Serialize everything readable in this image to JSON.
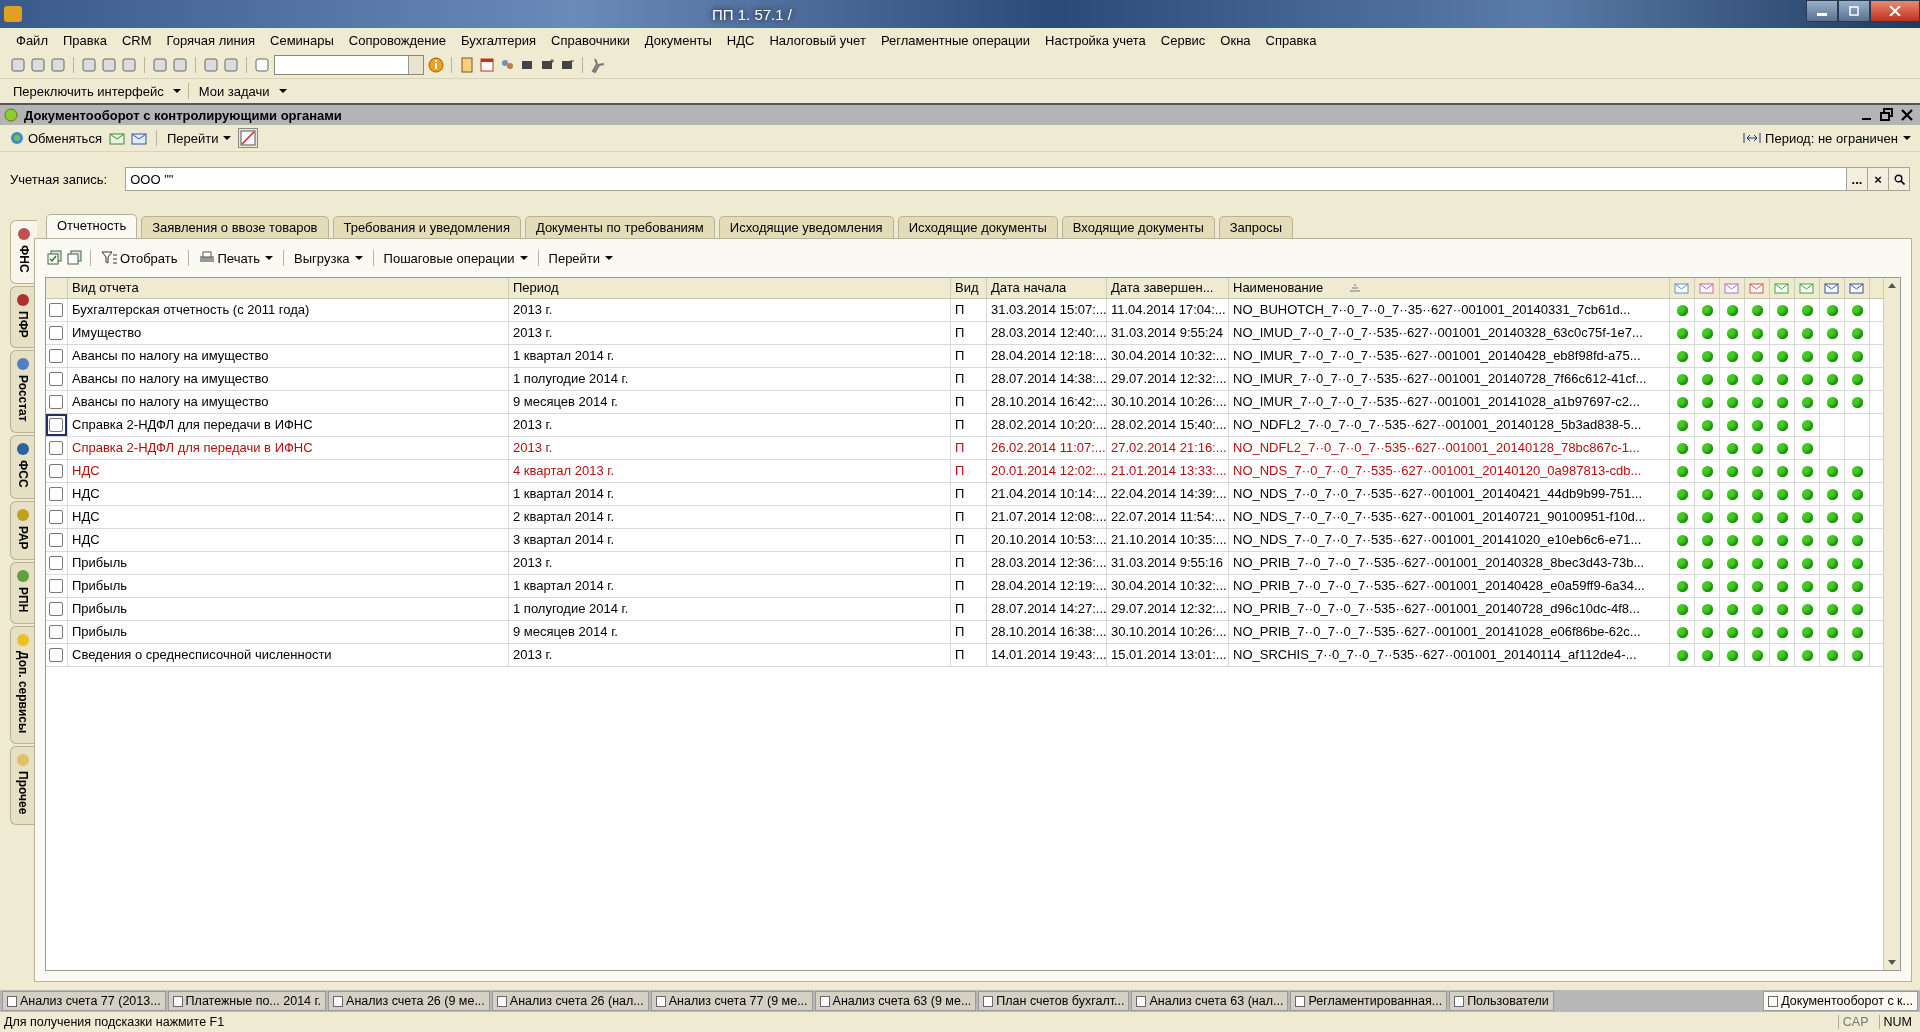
{
  "window": {
    "title": "ПП 1.  57.1 /"
  },
  "menu": [
    "Файл",
    "Правка",
    "CRM",
    "Горячая линия",
    "Семинары",
    "Сопровождение",
    "Бухгалтерия",
    "Справочники",
    "Документы",
    "НДС",
    "Налоговый учет",
    "Регламентные операции",
    "Настройка учета",
    "Сервис",
    "Окна",
    "Справка"
  ],
  "panel_buttons": [
    "Переключить интерфейс",
    "Мои задачи"
  ],
  "document": {
    "title": "Документооборот с контролирующими органами",
    "toolbar": {
      "exchange": "Обменяться",
      "goto": "Перейти",
      "period": "Период: не ограничен"
    },
    "account": {
      "label": "Учетная запись:",
      "value": "ООО \"\"",
      "buttons": [
        "...",
        "×"
      ]
    },
    "side_tabs": [
      {
        "label": "ФНС",
        "selected": true
      },
      {
        "label": "ПФР",
        "selected": false
      },
      {
        "label": "Росстат",
        "selected": false
      },
      {
        "label": "ФСС",
        "selected": false
      },
      {
        "label": "РАР",
        "selected": false
      },
      {
        "label": "РПН",
        "selected": false
      },
      {
        "label": "Доп. сервисы",
        "selected": false
      },
      {
        "label": "Прочее",
        "selected": false
      }
    ],
    "tabs": [
      {
        "label": "Отчетность",
        "selected": true
      },
      {
        "label": "Заявления о ввозе товаров",
        "selected": false
      },
      {
        "label": "Требования и уведомления",
        "selected": false
      },
      {
        "label": "Документы по требованиям",
        "selected": false
      },
      {
        "label": "Исходящие уведомления",
        "selected": false
      },
      {
        "label": "Исходящие документы",
        "selected": false
      },
      {
        "label": "Входящие документы",
        "selected": false
      },
      {
        "label": "Запросы",
        "selected": false
      }
    ],
    "list_toolbar": {
      "filter": "Отобрать",
      "print": "Печать",
      "export": "Выгрузка",
      "steps": "Пошаговые операции",
      "goto": "Перейти"
    },
    "table": {
      "columns": [
        "Вид отчета",
        "Период",
        "Вид",
        "Дата начала",
        "Дата завершен...",
        "Наименование"
      ],
      "rows": [
        {
          "checked": false,
          "focused": false,
          "error": false,
          "cells": [
            "Бухгалтерская отчетность (с 2011 года)",
            "2013 г.",
            "П",
            "31.03.2014 15:07:...",
            "11.04.2014 17:04:...",
            "NO_BUHOTCH_7··0_7··0_7··35··627··001001_20140331_7cb61d..."
          ],
          "indicators": [
            true,
            true,
            true,
            true,
            true,
            true,
            true,
            true
          ]
        },
        {
          "checked": false,
          "focused": false,
          "error": false,
          "cells": [
            "Имущество",
            "2013 г.",
            "П",
            "28.03.2014 12:40:...",
            "31.03.2014 9:55:24",
            "NO_IMUD_7··0_7··0_7··535··627··001001_20140328_63c0c75f-1e7..."
          ],
          "indicators": [
            true,
            true,
            true,
            true,
            true,
            true,
            true,
            true
          ]
        },
        {
          "checked": false,
          "focused": false,
          "error": false,
          "cells": [
            "Авансы по налогу на имущество",
            "1 квартал 2014 г.",
            "П",
            "28.04.2014 12:18:...",
            "30.04.2014 10:32:...",
            "NO_IMUR_7··0_7··0_7··535··627··001001_20140428_eb8f98fd-a75..."
          ],
          "indicators": [
            true,
            true,
            true,
            true,
            true,
            true,
            true,
            true
          ]
        },
        {
          "checked": false,
          "focused": false,
          "error": false,
          "cells": [
            "Авансы по налогу на имущество",
            "1 полугодие 2014 г.",
            "П",
            "28.07.2014 14:38:...",
            "29.07.2014 12:32:...",
            "NO_IMUR_7··0_7··0_7··535··627··001001_20140728_7f66c612-41cf..."
          ],
          "indicators": [
            true,
            true,
            true,
            true,
            true,
            true,
            true,
            true
          ]
        },
        {
          "checked": false,
          "focused": false,
          "error": false,
          "cells": [
            "Авансы по налогу на имущество",
            "9 месяцев 2014 г.",
            "П",
            "28.10.2014 16:42:...",
            "30.10.2014 10:26:...",
            "NO_IMUR_7··0_7··0_7··535··627··001001_20141028_a1b97697-c2..."
          ],
          "indicators": [
            true,
            true,
            true,
            true,
            true,
            true,
            true,
            true
          ]
        },
        {
          "checked": false,
          "focused": true,
          "error": false,
          "cells": [
            "Справка 2-НДФЛ для передачи в ИФНС",
            "2013 г.",
            "П",
            "28.02.2014 10:20:...",
            "28.02.2014 15:40:...",
            "NO_NDFL2_7··0_7··0_7··535··627··001001_20140128_5b3ad838-5..."
          ],
          "indicators": [
            true,
            true,
            true,
            true,
            true,
            true,
            false,
            false
          ]
        },
        {
          "checked": false,
          "focused": false,
          "error": true,
          "cells": [
            "Справка 2-НДФЛ для передачи в ИФНС",
            "2013 г.",
            "П",
            "26.02.2014 11:07:...",
            "27.02.2014 21:16:...",
            "NO_NDFL2_7··0_7··0_7··535··627··001001_20140128_78bc867c-1..."
          ],
          "indicators": [
            true,
            true,
            true,
            true,
            true,
            true,
            false,
            false
          ]
        },
        {
          "checked": false,
          "focused": false,
          "error": true,
          "cells": [
            "НДС",
            "4 квартал 2013 г.",
            "П",
            "20.01.2014 12:02:...",
            "21.01.2014 13:33:...",
            "NO_NDS_7··0_7··0_7··535··627··001001_20140120_0a987813-cdb..."
          ],
          "indicators": [
            true,
            true,
            true,
            true,
            true,
            true,
            true,
            true
          ]
        },
        {
          "checked": false,
          "focused": false,
          "error": false,
          "cells": [
            "НДС",
            "1 квартал 2014 г.",
            "П",
            "21.04.2014 10:14:...",
            "22.04.2014 14:39:...",
            "NO_NDS_7··0_7··0_7··535··627··001001_20140421_44db9b99-751..."
          ],
          "indicators": [
            true,
            true,
            true,
            true,
            true,
            true,
            true,
            true
          ]
        },
        {
          "checked": false,
          "focused": false,
          "error": false,
          "cells": [
            "НДС",
            "2 квартал 2014 г.",
            "П",
            "21.07.2014 12:08:...",
            "22.07.2014 11:54:...",
            "NO_NDS_7··0_7··0_7··535··627··001001_20140721_90100951-f10d..."
          ],
          "indicators": [
            true,
            true,
            true,
            true,
            true,
            true,
            true,
            true
          ]
        },
        {
          "checked": false,
          "focused": false,
          "error": false,
          "cells": [
            "НДС",
            "3 квартал 2014 г.",
            "П",
            "20.10.2014 10:53:...",
            "21.10.2014 10:35:...",
            "NO_NDS_7··0_7··0_7··535··627··001001_20141020_e10eb6c6-e71..."
          ],
          "indicators": [
            true,
            true,
            true,
            true,
            true,
            true,
            true,
            true
          ]
        },
        {
          "checked": false,
          "focused": false,
          "error": false,
          "cells": [
            "Прибыль",
            "2013 г.",
            "П",
            "28.03.2014 12:36:...",
            "31.03.2014 9:55:16",
            "NO_PRIB_7··0_7··0_7··535··627··001001_20140328_8bec3d43-73b..."
          ],
          "indicators": [
            true,
            true,
            true,
            true,
            true,
            true,
            true,
            true
          ]
        },
        {
          "checked": false,
          "focused": false,
          "error": false,
          "cells": [
            "Прибыль",
            "1 квартал 2014 г.",
            "П",
            "28.04.2014 12:19:...",
            "30.04.2014 10:32:...",
            "NO_PRIB_7··0_7··0_7··535··627··001001_20140428_e0a59ff9-6a34..."
          ],
          "indicators": [
            true,
            true,
            true,
            true,
            true,
            true,
            true,
            true
          ]
        },
        {
          "checked": false,
          "focused": false,
          "error": false,
          "cells": [
            "Прибыль",
            "1 полугодие 2014 г.",
            "П",
            "28.07.2014 14:27:...",
            "29.07.2014 12:32:...",
            "NO_PRIB_7··0_7··0_7··535··627··001001_20140728_d96c10dc-4f8..."
          ],
          "indicators": [
            true,
            true,
            true,
            true,
            true,
            true,
            true,
            true
          ]
        },
        {
          "checked": false,
          "focused": false,
          "error": false,
          "cells": [
            "Прибыль",
            "9 месяцев 2014 г.",
            "П",
            "28.10.2014 16:38:...",
            "30.10.2014 10:26:...",
            "NO_PRIB_7··0_7··0_7··535··627··001001_20141028_e06f86be-62c..."
          ],
          "indicators": [
            true,
            true,
            true,
            true,
            true,
            true,
            true,
            true
          ]
        },
        {
          "checked": false,
          "focused": false,
          "error": false,
          "cells": [
            "Сведения о среднесписочной численности",
            "2013 г.",
            "П",
            "14.01.2014 19:43:...",
            "15.01.2014 13:01:...",
            "NO_SRCHIS_7··0_7··0_7··535··627··001001_20140114_af112de4-..."
          ],
          "indicators": [
            true,
            true,
            true,
            true,
            true,
            true,
            true,
            true
          ]
        }
      ]
    }
  },
  "taskbar": [
    {
      "label": "Анализ счета 77 (2013...",
      "selected": false
    },
    {
      "label": "Платежные по... 2014 г.",
      "selected": false
    },
    {
      "label": "Анализ счета 26 (9 ме...",
      "selected": false
    },
    {
      "label": "Анализ счета 26 (нал...",
      "selected": false
    },
    {
      "label": "Анализ счета 77 (9 ме...",
      "selected": false
    },
    {
      "label": "Анализ счета 63 (9 ме...",
      "selected": false
    },
    {
      "label": "План счетов бухгалт...",
      "selected": false
    },
    {
      "label": "Анализ счета 63 (нал...",
      "selected": false
    },
    {
      "label": "Регламентированная...",
      "selected": false
    },
    {
      "label": "Пользователи",
      "selected": false
    },
    {
      "label": "Документооборот с к...",
      "selected": true
    }
  ],
  "status_bar": {
    "hint": "Для получения подсказки нажмите F1",
    "indicators": [
      "CAP",
      "NUM"
    ]
  }
}
